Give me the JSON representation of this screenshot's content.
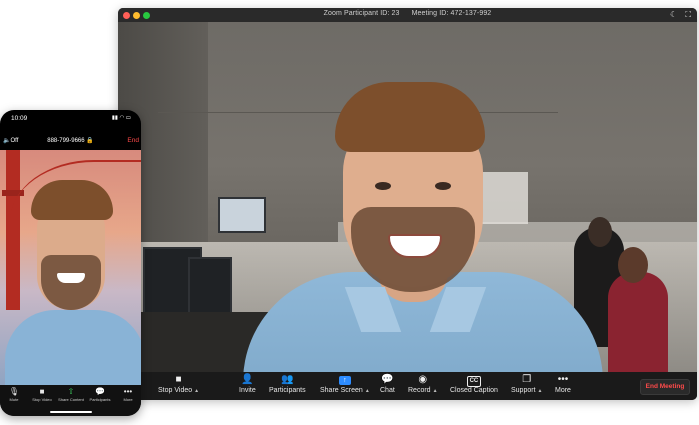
{
  "desktop": {
    "title": {
      "participant_id": "Zoom Participant ID: 23",
      "meeting_id": "Meeting ID: 472-137-992"
    },
    "toolbar": {
      "items": [
        {
          "label": "Stop Video",
          "icon": "video-camera-icon"
        },
        {
          "label": "Invite",
          "icon": "add-person-icon"
        },
        {
          "label": "Participants",
          "icon": "participants-icon"
        },
        {
          "label": "Share Screen",
          "icon": "share-screen-icon"
        },
        {
          "label": "Chat",
          "icon": "chat-icon"
        },
        {
          "label": "Record",
          "icon": "record-icon"
        },
        {
          "label": "Closed Caption",
          "icon": "closed-caption-icon"
        },
        {
          "label": "Support",
          "icon": "support-icon"
        },
        {
          "label": "More",
          "icon": "more-icon"
        }
      ],
      "end_meeting": "End Meeting"
    }
  },
  "phone": {
    "time": "10:09",
    "phone_number": "888-799-9666",
    "speaker_label": "Off",
    "end_label": "End",
    "toolbar": [
      {
        "label": "Mute",
        "icon": "microphone-icon"
      },
      {
        "label": "Stop Video",
        "icon": "video-camera-icon"
      },
      {
        "label": "Share Content",
        "icon": "share-content-icon"
      },
      {
        "label": "Participants",
        "icon": "participants-icon"
      },
      {
        "label": "More",
        "icon": "more-icon"
      }
    ]
  },
  "colors": {
    "accent": "#2d8cff",
    "end_red": "#ff4a4a",
    "toolbar_bg": "#1a1a1a"
  }
}
